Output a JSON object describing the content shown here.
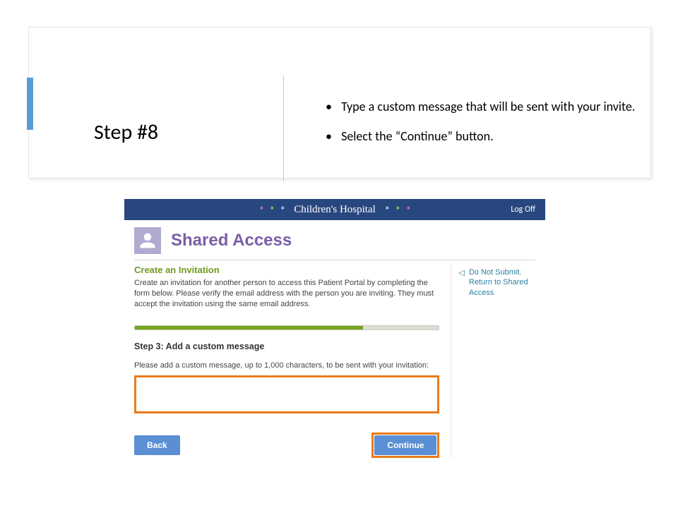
{
  "instruction": {
    "title": "Step #8",
    "bullets": [
      "Type a custom message that will be sent with your invite.",
      "Select the “Continue” button."
    ]
  },
  "portal": {
    "brand": "Children's Hospital",
    "logoff": "Log Off",
    "page_title": "Shared Access",
    "section_heading": "Create an Invitation",
    "section_description": "Create an invitation for another person to access this Patient Portal by completing the form below. Please verify the email address with the person you are inviting. They must accept the invitation using the same email address.",
    "progress_percent": 75,
    "step_label": "Step 3: Add a custom message",
    "step_sub": "Please add a custom message, up to 1,000 characters, to be sent with your invitation:",
    "message_value": "",
    "buttons": {
      "back": "Back",
      "continue": "Continue"
    },
    "side_link": {
      "line1": "Do Not Submit.",
      "line2": "Return to Shared Access"
    }
  }
}
